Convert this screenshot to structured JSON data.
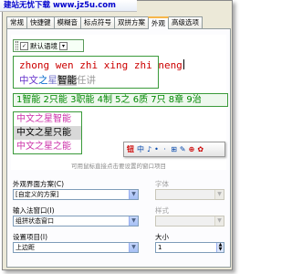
{
  "watermark": "建站无忧下载 www.jz5u.com",
  "tabs": [
    "常规",
    "快捷键",
    "模糊音",
    "标点符号",
    "双拼方案",
    "外观",
    "高级选项"
  ],
  "active_tab": "外观",
  "preview": {
    "toolbar_label": "默认语境",
    "composition_text": "zhong wen zhi xing zhi neng",
    "candidates": [
      "中文",
      "之",
      "星",
      "智能",
      "任讲"
    ],
    "horizontal_candidates": "1智能 2只能 3职能 4制 5之 6质 7只 8章 9治",
    "vertical_candidates": [
      "中文之星智能",
      "中文之星只能",
      "中文之星之能"
    ],
    "status_items": [
      "钮",
      "中",
      "♪",
      "•",
      "ㆍ",
      "⊞",
      "✎",
      "⊕",
      "✿"
    ],
    "hint": "可用鼠标直接点击要设置的窗口项目"
  },
  "form": {
    "scheme_label": "外观界面方案(C)",
    "scheme_value": "[自定义的方案]",
    "font_label": "字体",
    "font_value": "",
    "ime_window_label": "输入法窗口(I)",
    "ime_window_value": "组拼状态窗口",
    "style_label": "样式",
    "style_value": "",
    "setting_label": "设置项目(I)",
    "setting_value": "上边距",
    "size_label": "大小",
    "size_value": "1"
  }
}
